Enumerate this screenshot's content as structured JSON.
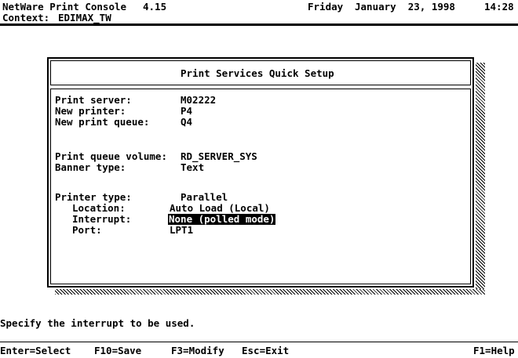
{
  "header": {
    "app_name": "NetWare Print Console",
    "version": "4.15",
    "day": "Friday",
    "date": "January  23, 1998",
    "time": "14:28",
    "context_label": "Context:",
    "context_value": "EDIMAX_TW"
  },
  "window": {
    "title": "Print Services Quick Setup",
    "fields": {
      "print_server": {
        "label": "Print server:",
        "value": "M02222"
      },
      "new_printer": {
        "label": "New printer:",
        "value": "P4"
      },
      "new_print_queue": {
        "label": "New print queue:",
        "value": "Q4"
      },
      "print_queue_volume": {
        "label": "Print queue volume:",
        "value": "RD_SERVER_SYS"
      },
      "banner_type": {
        "label": "Banner type:",
        "value": "Text"
      },
      "printer_type": {
        "label": "Printer type:",
        "value": "Parallel"
      },
      "location": {
        "label": "Location:",
        "value": "Auto Load (Local)"
      },
      "interrupt": {
        "label": "Interrupt:",
        "value": "None (polled mode)"
      },
      "port": {
        "label": "Port:",
        "value": "LPT1"
      }
    }
  },
  "status": {
    "hint": "Specify the interrupt to be used."
  },
  "function_keys": {
    "enter": "Enter=Select",
    "f10": "F10=Save",
    "f3": "F3=Modify",
    "esc": "Esc=Exit",
    "f1": "F1=Help"
  }
}
